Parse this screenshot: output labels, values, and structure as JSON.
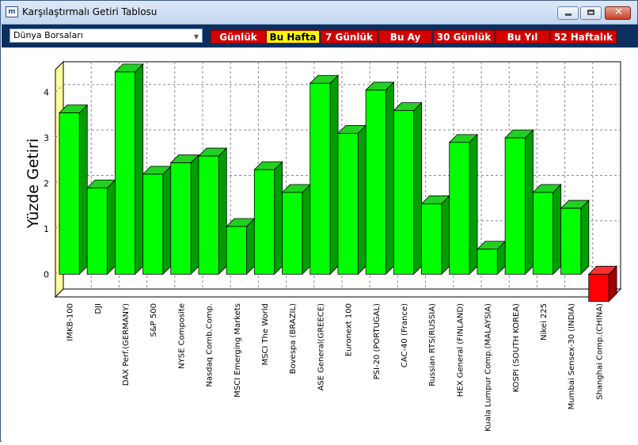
{
  "window": {
    "title": "Karşılaştırmalı Getiri Tablosu",
    "app_icon": "m"
  },
  "toolbar": {
    "market_select": "Dünya Borsaları",
    "periods": [
      "Günlük",
      "Bu Hafta",
      "7 Günlük",
      "Bu Ay",
      "30 Günlük",
      "Bu Yıl",
      "52 Haftalık"
    ],
    "active_period": "Bu Hafta"
  },
  "chart_data": {
    "type": "bar",
    "ylabel": "Yüzde Getiri",
    "ylim": [
      -0.5,
      4.5
    ],
    "yticks": [
      0,
      1,
      2,
      3,
      4
    ],
    "grid": true,
    "categories": [
      "IMKB-100",
      "DJI",
      "DAX Perf.(GERMANY)",
      "S&P 500",
      "NYSE Composite",
      "Nasdaq Comb.Comp.",
      "MSCI Emerging Markets",
      "MSCI The World",
      "Bovespa (BRAZIL)",
      "ASE General(GREECE)",
      "Euronext 100",
      "PSI-20 (PORTUGAL)",
      "CAC-40 (France)",
      "Russian RTS(RUSSIA)",
      "HEX General (FINLAND)",
      "Kuala Lumpur Comp.(MALAYSIA)",
      "KOSPI (SOUTH KOREA)",
      "Nikei 225",
      "Mumbai Sensex-30 (INDIA)",
      "Shanghai Comp.(CHINA)"
    ],
    "values": [
      3.55,
      1.9,
      4.45,
      2.2,
      2.45,
      2.6,
      1.05,
      2.3,
      1.8,
      4.2,
      3.1,
      4.05,
      3.6,
      1.55,
      2.9,
      0.55,
      3.0,
      1.8,
      1.45,
      -0.6
    ],
    "colors": {
      "positive": "#00ff00",
      "negative": "#ff0000",
      "back_wall": "#ffffa0"
    }
  }
}
